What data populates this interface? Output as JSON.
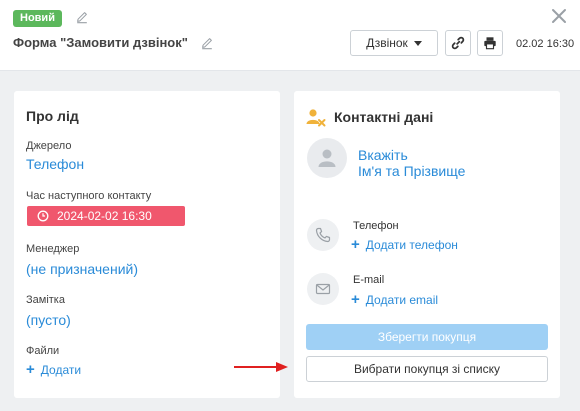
{
  "header": {
    "status_badge": "Новий",
    "form_title": "Форма \"Замовити дзвінок\"",
    "type_dropdown": "Дзвінок",
    "date": "02.02 16:30"
  },
  "lead": {
    "title": "Про лід",
    "source_label": "Джерело",
    "source_value": "Телефон",
    "next_contact_label": "Час наступного контакту",
    "next_contact_value": "2024-02-02 16:30",
    "manager_label": "Менеджер",
    "manager_value": "(не призначений)",
    "note_label": "Замітка",
    "note_value": "(пусто)",
    "files_label": "Файли",
    "files_add": "Додати"
  },
  "contact": {
    "title": "Контактні дані",
    "name_line1": "Вкажіть",
    "name_line2": "Ім'я та Прізвище",
    "phone_label": "Телефон",
    "phone_add": "Додати телефон",
    "email_label": "E-mail",
    "email_add": "Додати email",
    "save_button": "Зберегти покупця",
    "pick_button": "Вибрати покупця зі списку"
  },
  "colors": {
    "badge": "#5cb85c",
    "link": "#2a8bd8",
    "date_pill": "#f0576d",
    "save_button": "#9fd0f5",
    "arrow": "#e02020",
    "contact_icon": "#f0b23a"
  },
  "icons": {
    "edit": "pencil-icon",
    "close": "close-icon",
    "link": "chain-link-icon",
    "print": "printer-icon",
    "clock": "clock-icon",
    "contact_header": "person-x-icon",
    "avatar": "person-icon",
    "phone": "phone-icon",
    "email": "envelope-icon"
  }
}
